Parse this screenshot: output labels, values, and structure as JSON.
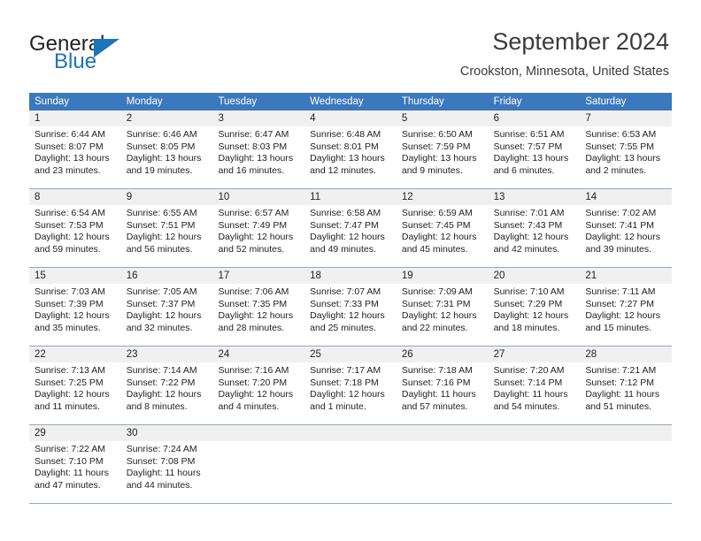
{
  "brand": {
    "name_part1": "General",
    "name_part2": "Blue"
  },
  "header": {
    "title": "September 2024",
    "location": "Crookston, Minnesota, United States"
  },
  "colors": {
    "header_blue": "#3c78bd",
    "brand_blue": "#1b75bb",
    "daynum_band": "#f0f0f0",
    "row_rule": "#8fa8c8"
  },
  "weekdays": [
    "Sunday",
    "Monday",
    "Tuesday",
    "Wednesday",
    "Thursday",
    "Friday",
    "Saturday"
  ],
  "weeks": [
    {
      "days": [
        {
          "num": "1",
          "sunrise": "Sunrise: 6:44 AM",
          "sunset": "Sunset: 8:07 PM",
          "daylight1": "Daylight: 13 hours",
          "daylight2": "and 23 minutes."
        },
        {
          "num": "2",
          "sunrise": "Sunrise: 6:46 AM",
          "sunset": "Sunset: 8:05 PM",
          "daylight1": "Daylight: 13 hours",
          "daylight2": "and 19 minutes."
        },
        {
          "num": "3",
          "sunrise": "Sunrise: 6:47 AM",
          "sunset": "Sunset: 8:03 PM",
          "daylight1": "Daylight: 13 hours",
          "daylight2": "and 16 minutes."
        },
        {
          "num": "4",
          "sunrise": "Sunrise: 6:48 AM",
          "sunset": "Sunset: 8:01 PM",
          "daylight1": "Daylight: 13 hours",
          "daylight2": "and 12 minutes."
        },
        {
          "num": "5",
          "sunrise": "Sunrise: 6:50 AM",
          "sunset": "Sunset: 7:59 PM",
          "daylight1": "Daylight: 13 hours",
          "daylight2": "and 9 minutes."
        },
        {
          "num": "6",
          "sunrise": "Sunrise: 6:51 AM",
          "sunset": "Sunset: 7:57 PM",
          "daylight1": "Daylight: 13 hours",
          "daylight2": "and 6 minutes."
        },
        {
          "num": "7",
          "sunrise": "Sunrise: 6:53 AM",
          "sunset": "Sunset: 7:55 PM",
          "daylight1": "Daylight: 13 hours",
          "daylight2": "and 2 minutes."
        }
      ]
    },
    {
      "days": [
        {
          "num": "8",
          "sunrise": "Sunrise: 6:54 AM",
          "sunset": "Sunset: 7:53 PM",
          "daylight1": "Daylight: 12 hours",
          "daylight2": "and 59 minutes."
        },
        {
          "num": "9",
          "sunrise": "Sunrise: 6:55 AM",
          "sunset": "Sunset: 7:51 PM",
          "daylight1": "Daylight: 12 hours",
          "daylight2": "and 56 minutes."
        },
        {
          "num": "10",
          "sunrise": "Sunrise: 6:57 AM",
          "sunset": "Sunset: 7:49 PM",
          "daylight1": "Daylight: 12 hours",
          "daylight2": "and 52 minutes."
        },
        {
          "num": "11",
          "sunrise": "Sunrise: 6:58 AM",
          "sunset": "Sunset: 7:47 PM",
          "daylight1": "Daylight: 12 hours",
          "daylight2": "and 49 minutes."
        },
        {
          "num": "12",
          "sunrise": "Sunrise: 6:59 AM",
          "sunset": "Sunset: 7:45 PM",
          "daylight1": "Daylight: 12 hours",
          "daylight2": "and 45 minutes."
        },
        {
          "num": "13",
          "sunrise": "Sunrise: 7:01 AM",
          "sunset": "Sunset: 7:43 PM",
          "daylight1": "Daylight: 12 hours",
          "daylight2": "and 42 minutes."
        },
        {
          "num": "14",
          "sunrise": "Sunrise: 7:02 AM",
          "sunset": "Sunset: 7:41 PM",
          "daylight1": "Daylight: 12 hours",
          "daylight2": "and 39 minutes."
        }
      ]
    },
    {
      "days": [
        {
          "num": "15",
          "sunrise": "Sunrise: 7:03 AM",
          "sunset": "Sunset: 7:39 PM",
          "daylight1": "Daylight: 12 hours",
          "daylight2": "and 35 minutes."
        },
        {
          "num": "16",
          "sunrise": "Sunrise: 7:05 AM",
          "sunset": "Sunset: 7:37 PM",
          "daylight1": "Daylight: 12 hours",
          "daylight2": "and 32 minutes."
        },
        {
          "num": "17",
          "sunrise": "Sunrise: 7:06 AM",
          "sunset": "Sunset: 7:35 PM",
          "daylight1": "Daylight: 12 hours",
          "daylight2": "and 28 minutes."
        },
        {
          "num": "18",
          "sunrise": "Sunrise: 7:07 AM",
          "sunset": "Sunset: 7:33 PM",
          "daylight1": "Daylight: 12 hours",
          "daylight2": "and 25 minutes."
        },
        {
          "num": "19",
          "sunrise": "Sunrise: 7:09 AM",
          "sunset": "Sunset: 7:31 PM",
          "daylight1": "Daylight: 12 hours",
          "daylight2": "and 22 minutes."
        },
        {
          "num": "20",
          "sunrise": "Sunrise: 7:10 AM",
          "sunset": "Sunset: 7:29 PM",
          "daylight1": "Daylight: 12 hours",
          "daylight2": "and 18 minutes."
        },
        {
          "num": "21",
          "sunrise": "Sunrise: 7:11 AM",
          "sunset": "Sunset: 7:27 PM",
          "daylight1": "Daylight: 12 hours",
          "daylight2": "and 15 minutes."
        }
      ]
    },
    {
      "days": [
        {
          "num": "22",
          "sunrise": "Sunrise: 7:13 AM",
          "sunset": "Sunset: 7:25 PM",
          "daylight1": "Daylight: 12 hours",
          "daylight2": "and 11 minutes."
        },
        {
          "num": "23",
          "sunrise": "Sunrise: 7:14 AM",
          "sunset": "Sunset: 7:22 PM",
          "daylight1": "Daylight: 12 hours",
          "daylight2": "and 8 minutes."
        },
        {
          "num": "24",
          "sunrise": "Sunrise: 7:16 AM",
          "sunset": "Sunset: 7:20 PM",
          "daylight1": "Daylight: 12 hours",
          "daylight2": "and 4 minutes."
        },
        {
          "num": "25",
          "sunrise": "Sunrise: 7:17 AM",
          "sunset": "Sunset: 7:18 PM",
          "daylight1": "Daylight: 12 hours",
          "daylight2": "and 1 minute."
        },
        {
          "num": "26",
          "sunrise": "Sunrise: 7:18 AM",
          "sunset": "Sunset: 7:16 PM",
          "daylight1": "Daylight: 11 hours",
          "daylight2": "and 57 minutes."
        },
        {
          "num": "27",
          "sunrise": "Sunrise: 7:20 AM",
          "sunset": "Sunset: 7:14 PM",
          "daylight1": "Daylight: 11 hours",
          "daylight2": "and 54 minutes."
        },
        {
          "num": "28",
          "sunrise": "Sunrise: 7:21 AM",
          "sunset": "Sunset: 7:12 PM",
          "daylight1": "Daylight: 11 hours",
          "daylight2": "and 51 minutes."
        }
      ]
    },
    {
      "days": [
        {
          "num": "29",
          "sunrise": "Sunrise: 7:22 AM",
          "sunset": "Sunset: 7:10 PM",
          "daylight1": "Daylight: 11 hours",
          "daylight2": "and 47 minutes."
        },
        {
          "num": "30",
          "sunrise": "Sunrise: 7:24 AM",
          "sunset": "Sunset: 7:08 PM",
          "daylight1": "Daylight: 11 hours",
          "daylight2": "and 44 minutes."
        },
        {
          "num": "",
          "sunrise": "",
          "sunset": "",
          "daylight1": "",
          "daylight2": ""
        },
        {
          "num": "",
          "sunrise": "",
          "sunset": "",
          "daylight1": "",
          "daylight2": ""
        },
        {
          "num": "",
          "sunrise": "",
          "sunset": "",
          "daylight1": "",
          "daylight2": ""
        },
        {
          "num": "",
          "sunrise": "",
          "sunset": "",
          "daylight1": "",
          "daylight2": ""
        },
        {
          "num": "",
          "sunrise": "",
          "sunset": "",
          "daylight1": "",
          "daylight2": ""
        }
      ]
    }
  ]
}
